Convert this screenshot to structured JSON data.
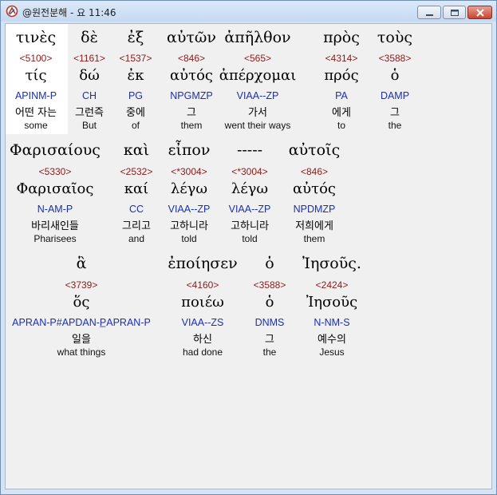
{
  "window": {
    "title": "@원전분해 - 요 11:46"
  },
  "rows": [
    [
      {
        "greek": "τινὲς",
        "strong": "<5100>",
        "lemma": "τίς",
        "morph": "APINM-P",
        "korean": "어떤 자는",
        "english": "some"
      },
      {
        "greek": "δὲ",
        "strong": "<1161>",
        "lemma": "δώ",
        "morph": "CH",
        "korean": "그런즉",
        "english": "But"
      },
      {
        "greek": "ἐξ",
        "strong": "<1537>",
        "lemma": "ἐκ",
        "morph": "PG",
        "korean": "중에",
        "english": "of"
      },
      {
        "greek": "αὐτῶν",
        "strong": "<846>",
        "lemma": "αὐτός",
        "morph": "NPGMZP",
        "korean": "그",
        "english": "them"
      },
      {
        "greek": "ἀπῆλθον",
        "strong": "<565>",
        "lemma": "ἀπέρχομαι",
        "morph": "VIAA--ZP",
        "korean": "가서",
        "english": "went their ways"
      },
      {
        "greek": "πρὸς",
        "strong": "<4314>",
        "lemma": "πρός",
        "morph": "PA",
        "korean": "에게",
        "english": "to"
      },
      {
        "greek": "τοὺς",
        "strong": "<3588>",
        "lemma": "ὁ",
        "morph": "DAMP",
        "korean": "그",
        "english": "the"
      }
    ],
    [
      {
        "greek": "Φαρισαίους",
        "strong": "<5330>",
        "lemma": "Φαρισαῖος",
        "morph": "N-AM-P",
        "korean": "바리새인들",
        "english": "Pharisees"
      },
      {
        "greek": "καὶ",
        "strong": "<2532>",
        "lemma": "καί",
        "morph": "CC",
        "korean": "그리고",
        "english": "and"
      },
      {
        "greek": "εἶπον",
        "strong": "<*3004>",
        "lemma": "λέγω",
        "morph": "VIAA--ZP",
        "korean": "고하니라",
        "english": "told"
      },
      {
        "greek": "-----",
        "strong": "<*3004>",
        "lemma": "λέγω",
        "morph": "VIAA--ZP",
        "korean": "고하니라",
        "english": "told"
      },
      {
        "greek": "αὐτοῖς",
        "strong": "<846>",
        "lemma": "αὐτός",
        "morph": "NPDMZP",
        "korean": "저희에게",
        "english": "them"
      }
    ],
    [
      {
        "greek": "ἃ",
        "strong": "<3739>",
        "lemma": "ὅς",
        "morph": "APRAN-P#APDAN-P̲APRAN-P",
        "korean": "일을",
        "english": "what things"
      },
      {
        "greek": "ἐποίησεν",
        "strong": "<4160>",
        "lemma": "ποιέω",
        "morph": "VIAA--ZS",
        "korean": "하신",
        "english": "had done"
      },
      {
        "greek": "ὁ",
        "strong": "<3588>",
        "lemma": "ὁ",
        "morph": "DNMS",
        "korean": "그",
        "english": "the"
      },
      {
        "greek": "Ἰησοῦς.",
        "strong": "<2424>",
        "lemma": "Ἰησοῦς",
        "morph": "N-NM-S",
        "korean": "예수의",
        "english": "Jesus"
      }
    ]
  ]
}
